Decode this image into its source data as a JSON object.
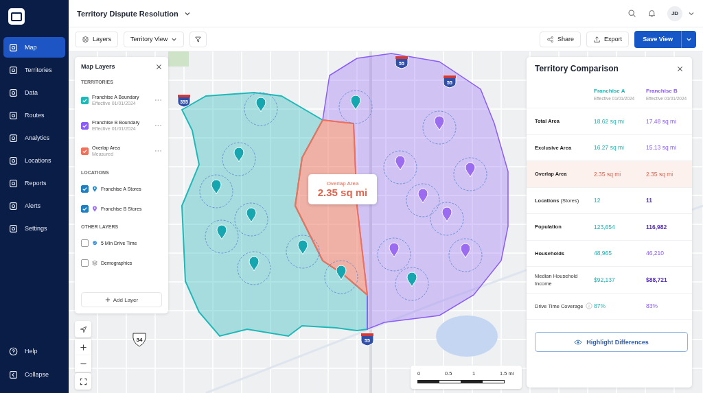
{
  "sidebar": {
    "items": [
      {
        "label": "Map",
        "selected": true
      },
      {
        "label": "Territories",
        "selected": false
      },
      {
        "label": "Data",
        "selected": false
      },
      {
        "label": "Routes",
        "selected": false
      },
      {
        "label": "Analytics",
        "selected": false
      },
      {
        "label": "Locations",
        "selected": false
      },
      {
        "label": "Reports",
        "selected": false
      },
      {
        "label": "Alerts",
        "selected": false
      },
      {
        "label": "Settings",
        "selected": false
      }
    ],
    "bottom_items": [
      "Help",
      "Collapse"
    ]
  },
  "header": {
    "title": "Territory Dispute Resolution",
    "avatar": "JD"
  },
  "toolbar": {
    "layers": "Layers",
    "view": "Territory View",
    "share": "Share",
    "export": "Export",
    "save": "Save View"
  },
  "layers_panel": {
    "title": "Map Layers",
    "sections": [
      {
        "heading": "TERRITORIES",
        "items": [
          {
            "kind": "territory",
            "label": "Franchise A Boundary",
            "sublabel": "Effective 01/01/2024",
            "checked": true,
            "color": "#1fb8b8"
          },
          {
            "kind": "territory",
            "label": "Franchise B Boundary",
            "sublabel": "Effective 01/01/2024",
            "checked": true,
            "color": "#8b5cf6"
          },
          {
            "kind": "territory",
            "label": "Overlap Area",
            "sublabel": "Measured",
            "checked": true,
            "color": "#f0705a"
          }
        ]
      },
      {
        "heading": "LOCATIONS",
        "items": [
          {
            "kind": "location",
            "label": "Franchise A Stores",
            "checked": true,
            "color": "#1e88c8"
          },
          {
            "kind": "location",
            "label": "Franchise B Stores",
            "checked": true,
            "color": "#9b6cf0"
          }
        ]
      },
      {
        "heading": "OTHER LAYERS",
        "items": [
          {
            "kind": "drive",
            "label": "5 Min Drive Time",
            "checked": false
          },
          {
            "kind": "stack",
            "label": "Demographics",
            "checked": false
          }
        ]
      }
    ],
    "add_button": "Add Layer"
  },
  "map": {
    "tooltip": {
      "label": "Overlap Area",
      "value": "2.35 sq mi"
    },
    "shields": [
      {
        "kind": "interstate",
        "number": "355"
      },
      {
        "kind": "interstate",
        "number": "55"
      },
      {
        "kind": "interstate",
        "number": "55"
      },
      {
        "kind": "us",
        "number": "34"
      },
      {
        "kind": "interstate",
        "number": "55"
      }
    ],
    "scale": [
      "0",
      "0.5",
      "1",
      "1.5 mi"
    ]
  },
  "comparison": {
    "title": "Territory Comparison",
    "columns": [
      {
        "name": "Franchise A",
        "sub": "Effective 01/01/2024",
        "color": "#22b5b5"
      },
      {
        "name": "Franchise B",
        "sub": "Effective 01/01/2024",
        "color": "#8b5cf6"
      }
    ],
    "rows": [
      {
        "label": "Total Area",
        "bold": true,
        "highlighted": false,
        "strong": false,
        "info": false,
        "values": [
          "18.62 sq mi",
          "17.48 sq mi"
        ]
      },
      {
        "label": "Exclusive Area",
        "bold": true,
        "highlighted": false,
        "strong": false,
        "info": false,
        "values": [
          "16.27 sq mi",
          "15.13 sq mi"
        ]
      },
      {
        "label": "Overlap Area",
        "bold": true,
        "highlighted": true,
        "strong": false,
        "info": false,
        "values": [
          "2.35 sq mi",
          "2.35 sq mi"
        ]
      },
      {
        "label": "**Locations** (Stores)",
        "bold": false,
        "highlighted": false,
        "strong": true,
        "info": false,
        "values": [
          "12",
          "11"
        ]
      },
      {
        "label": "Population",
        "bold": true,
        "highlighted": false,
        "strong": true,
        "info": false,
        "values": [
          "123,654",
          "116,982"
        ]
      },
      {
        "label": "Households",
        "bold": true,
        "highlighted": false,
        "strong": false,
        "info": false,
        "values": [
          "48,965",
          "46,210"
        ]
      },
      {
        "label": "Median Household Income",
        "bold": false,
        "highlighted": false,
        "strong": true,
        "info": false,
        "values": [
          "$92,137",
          "$88,721"
        ]
      },
      {
        "label": "Drive Time Coverage",
        "bold": false,
        "highlighted": false,
        "strong": false,
        "info": true,
        "values": [
          "87%",
          "83%"
        ]
      }
    ],
    "button": "Highlight Differences"
  }
}
